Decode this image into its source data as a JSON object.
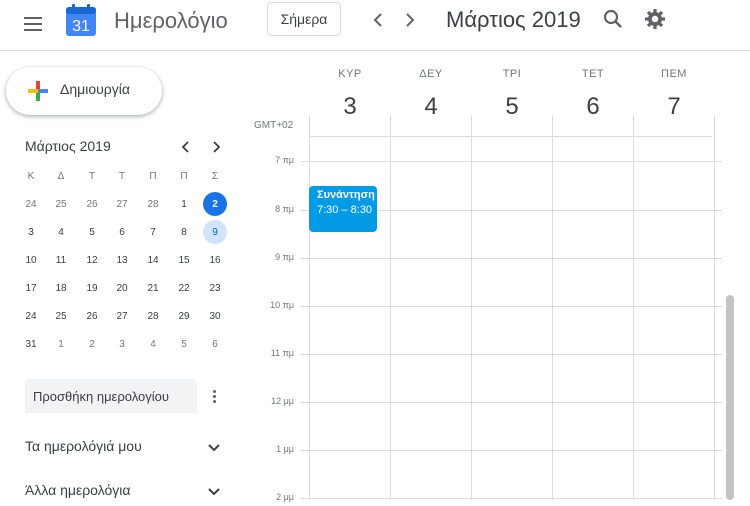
{
  "header": {
    "app_title": "Ημερολόγιο",
    "logo_number": "31",
    "today_label": "Σήμερα",
    "current_period": "Μάρτιος 2019"
  },
  "sidebar": {
    "create_label": "Δημιουργία",
    "mini_calendar": {
      "title": "Μάρτιος 2019",
      "weekdays": [
        "Κ",
        "Δ",
        "Τ",
        "Τ",
        "Π",
        "Π",
        "Σ"
      ],
      "weeks": [
        [
          "24",
          "25",
          "26",
          "27",
          "28",
          "1",
          "2"
        ],
        [
          "3",
          "4",
          "5",
          "6",
          "7",
          "8",
          "9"
        ],
        [
          "10",
          "11",
          "12",
          "13",
          "14",
          "15",
          "16"
        ],
        [
          "17",
          "18",
          "19",
          "20",
          "21",
          "22",
          "23"
        ],
        [
          "24",
          "25",
          "26",
          "27",
          "28",
          "29",
          "30"
        ],
        [
          "31",
          "1",
          "2",
          "3",
          "4",
          "5",
          "6"
        ]
      ]
    },
    "add_calendar_placeholder": "Προσθήκη ημερολογίου",
    "my_calendars_label": "Τα ημερολόγιά μου",
    "other_calendars_label": "Άλλα ημερολόγια"
  },
  "week_view": {
    "timezone": "GMT+02",
    "days": [
      {
        "name": "ΚΥΡ",
        "number": "3"
      },
      {
        "name": "ΔΕΥ",
        "number": "4"
      },
      {
        "name": "ΤΡΙ",
        "number": "5"
      },
      {
        "name": "ΤΕΤ",
        "number": "6"
      },
      {
        "name": "ΠΕΜ",
        "number": "7"
      }
    ],
    "time_labels": [
      "7 πμ",
      "8 πμ",
      "9 πμ",
      "10 πμ",
      "11 πμ",
      "12 μμ",
      "1 μμ",
      "2 μμ"
    ],
    "event": {
      "title": "Συνάντηση",
      "time": "7:30 – 8:30"
    }
  },
  "colors": {
    "accent": "#1a73e8",
    "event": "#039be5",
    "selected": "#d2e3fc"
  }
}
